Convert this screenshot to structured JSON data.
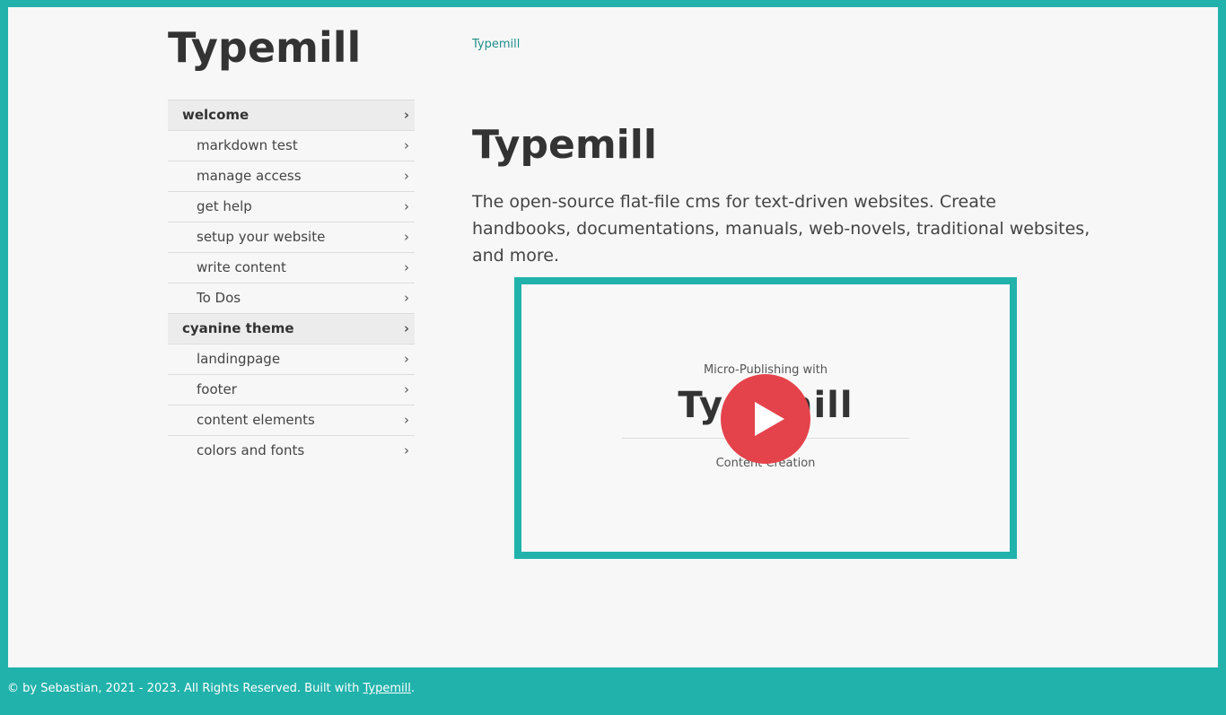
{
  "site": {
    "logo": "Typemill"
  },
  "breadcrumb": {
    "label": "Typemill"
  },
  "navigation": {
    "items": [
      {
        "label": "welcome",
        "level": 1
      },
      {
        "label": "markdown test",
        "level": 2
      },
      {
        "label": "manage access",
        "level": 2
      },
      {
        "label": "get help",
        "level": 2
      },
      {
        "label": "setup your website",
        "level": 2
      },
      {
        "label": "write content",
        "level": 2
      },
      {
        "label": "To Dos",
        "level": 2
      },
      {
        "label": "cyanine theme",
        "level": 1
      },
      {
        "label": "landingpage",
        "level": 2
      },
      {
        "label": "footer",
        "level": 2
      },
      {
        "label": "content elements",
        "level": 2
      },
      {
        "label": "colors and fonts",
        "level": 2
      }
    ],
    "chevron": "›"
  },
  "main": {
    "title": "Typemill",
    "lead": "The open-source flat-file cms for text-driven websites. Create handbooks, documentations, manuals, web-novels, traditional websites, and more."
  },
  "video": {
    "subtitle": "Micro-Publishing with",
    "brand": "Typemill",
    "caption": "Content Creation",
    "play_icon": "play-icon"
  },
  "footer": {
    "text": "© by Sebastian, 2021 - 2023. All Rights Reserved. Built with ",
    "link": "Typemill",
    "end": "."
  },
  "colors": {
    "accent": "#21b2ab",
    "play_button": "#e5434b",
    "background": "#f7f7f7"
  }
}
